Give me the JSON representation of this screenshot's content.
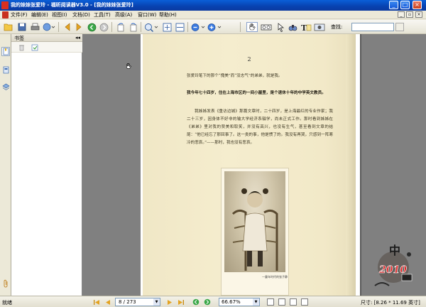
{
  "window": {
    "title": "我的妹妹张爱玲 - 福昕阅读器V3.0 - [我的妹妹张爱玲]",
    "minimize": "_",
    "maximize": "□",
    "close": "×"
  },
  "menu": {
    "items": [
      {
        "label": "文件(F)"
      },
      {
        "label": "编辑(E)"
      },
      {
        "label": "视图(I)"
      },
      {
        "label": "文档(D)"
      },
      {
        "label": "工具(T)"
      },
      {
        "label": "高级(A)"
      },
      {
        "label": "窗口(W)"
      },
      {
        "label": "帮助(H)"
      }
    ],
    "mdi_minimize": "_",
    "mdi_restore": "▫",
    "mdi_close": "×"
  },
  "toolbar": {
    "find_label": "查找:",
    "find_value": ""
  },
  "bookmark_panel": {
    "title": "书签",
    "collapse": "◂◂"
  },
  "document": {
    "page_number": "2",
    "paragraphs": [
      {
        "text": "张爱玲笔下的那个“傀美”而“没志气”的弟弟，就是我。",
        "bold": false
      },
      {
        "text": "我今年七十四岁，住在上海市区的一间小屋里，是个退休十年的中学英文教员。",
        "bold": true
      },
      {
        "text": "我姊姊发表《重访边城》那篇文章时，二十四岁，是上海最红的专业作家；我二十三岁，因身体不好非的输大学经济系辍学，尚未正式工作。那时看到姊姊在《弟弟》里对我的赞美和取笑，并没有高兴，也没有生气，甚至看到文章的结尾：“他已经忘了那回事了。这一类的事，他是惯了的。我没有再哭，只感到一阵寒冷的悲哀。”——那时，我也没有悲哀。",
        "bold": false
      }
    ],
    "photo_caption": "一童年时代的张子静"
  },
  "status": {
    "ready": "就绪",
    "page": "8 / 273",
    "zoom": "66.67%",
    "size": "尺寸: [8.26 * 11.69 英寸]"
  },
  "watermark": {
    "year": "2010",
    "glyph": "中"
  }
}
